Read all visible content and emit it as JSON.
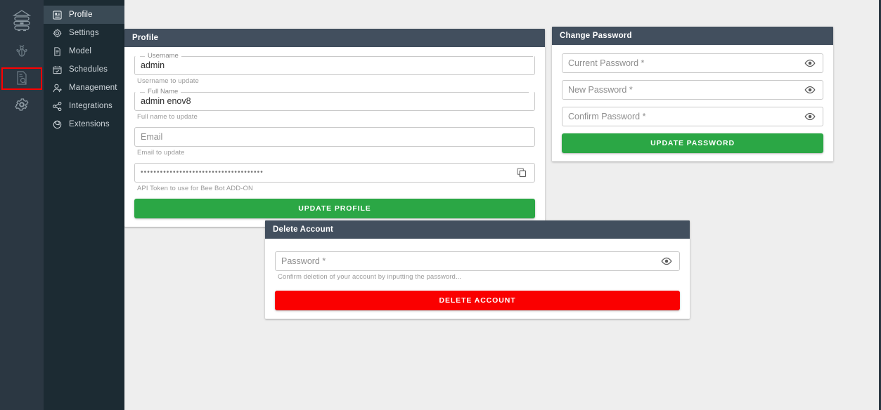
{
  "rail": {
    "items": [
      {
        "name": "beehive-logo-icon",
        "label": "Beehive"
      },
      {
        "name": "bee-icon",
        "label": "Bee"
      },
      {
        "name": "document-search-icon",
        "label": "Reports"
      },
      {
        "name": "gear-icon",
        "label": "Settings"
      }
    ],
    "highlight_color": "#ff0000",
    "background": "#2b3742"
  },
  "menu": {
    "background": "#1c2b33",
    "active_background": "#3a4a55",
    "items": [
      {
        "label": "Profile",
        "icon": "profile-icon",
        "active": true
      },
      {
        "label": "Settings",
        "icon": "gear-icon",
        "active": false
      },
      {
        "label": "Model",
        "icon": "model-document-icon",
        "active": false
      },
      {
        "label": "Schedules",
        "icon": "calendar-check-icon",
        "active": false
      },
      {
        "label": "Management",
        "icon": "user-add-icon",
        "active": false
      },
      {
        "label": "Integrations",
        "icon": "share-nodes-icon",
        "active": false
      },
      {
        "label": "Extensions",
        "icon": "extensions-target-icon",
        "active": false
      }
    ]
  },
  "profile_card": {
    "title": "Profile",
    "username": {
      "label": "Username",
      "value": "admin",
      "helper": "Username to update"
    },
    "fullname": {
      "label": "Full Name",
      "value": "admin enov8",
      "helper": "Full name to update"
    },
    "email": {
      "placeholder": "Email",
      "value": "",
      "helper": "Email to update"
    },
    "api_token": {
      "value": "••••••••••••••••••••••••••••••••••••••",
      "helper": "API Token to use for Bee Bot ADD-ON",
      "copy_icon": "copy-icon"
    },
    "update_button": "UPDATE PROFILE",
    "button_color": "#2ba745"
  },
  "password_card": {
    "title": "Change Password",
    "fields": [
      {
        "placeholder": "Current Password *",
        "value": "",
        "icon": "eye-icon"
      },
      {
        "placeholder": "New Password *",
        "value": "",
        "icon": "eye-icon"
      },
      {
        "placeholder": "Confirm Password *",
        "value": "",
        "icon": "eye-icon"
      }
    ],
    "update_button": "UPDATE PASSWORD",
    "button_color": "#2ba745"
  },
  "delete_card": {
    "title": "Delete Account",
    "password": {
      "placeholder": "Password *",
      "value": "",
      "icon": "eye-icon",
      "helper": "Confirm deletion of your account by inputting the password..."
    },
    "delete_button": "DELETE ACCOUNT",
    "button_color": "#fa0000"
  },
  "theme": {
    "card_header_bg": "#424f5e",
    "page_bg": "#eeeeee"
  }
}
